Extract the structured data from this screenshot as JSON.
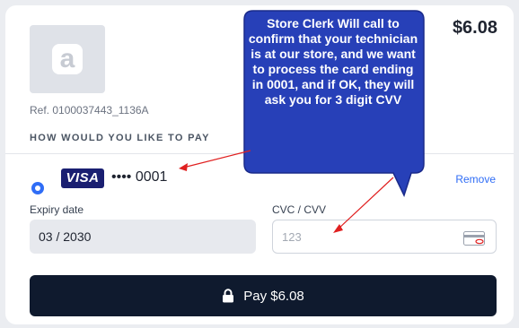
{
  "checkout": {
    "amount": "$6.08",
    "reference": "Ref. 0100037443_1136A",
    "prompt": "HOW WOULD YOU LIKE TO PAY"
  },
  "saved_card": {
    "brand": "VISA",
    "masked_number": "•••• 0001",
    "remove_label": "Remove",
    "selected": true
  },
  "expiry": {
    "label": "Expiry date",
    "value": "03 / 2030"
  },
  "cvc": {
    "label": "CVC / CVV",
    "placeholder": "123"
  },
  "pay_button": {
    "label": "Pay $6.08",
    "icon": "lock-icon"
  },
  "annotation": {
    "text": "Store Clerk Will call to confirm that your technician is at our store, and we want to process the card ending in 0001, and if OK, they will ask you for 3 digit CVV",
    "fill": "#2740b8",
    "arrow_color": "#e02020"
  },
  "colors": {
    "accent": "#2f6df6",
    "button_bg": "#0f1a2e",
    "visa_blue": "#1a1f71"
  }
}
